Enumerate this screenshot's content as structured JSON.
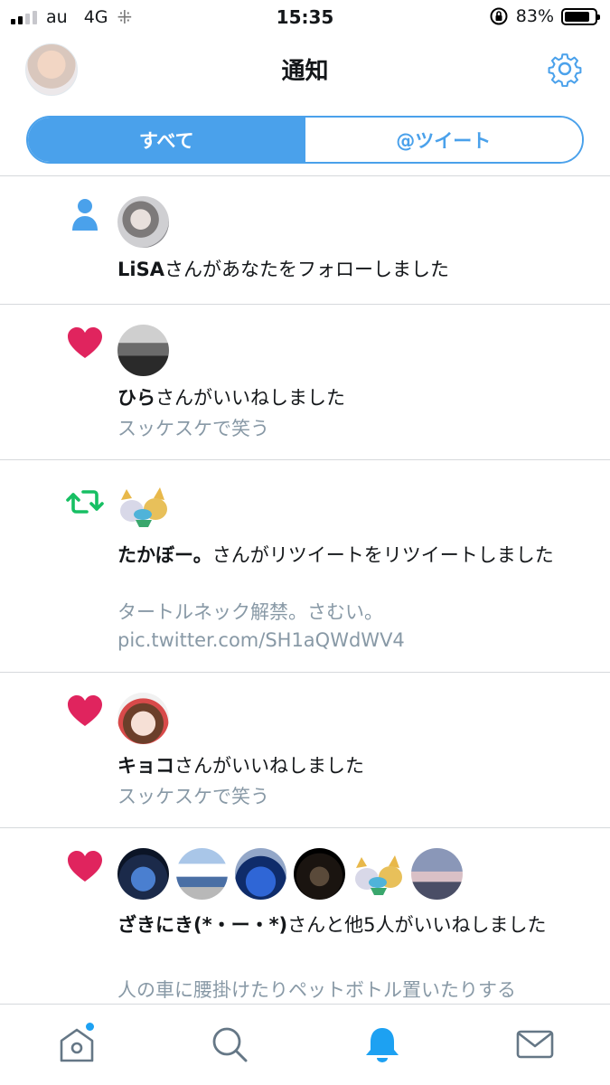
{
  "status_bar": {
    "carrier": "au",
    "network": "4G",
    "time": "15:35",
    "battery": "83%",
    "battery_level": 0.83,
    "signal_bars": 2
  },
  "header": {
    "title": "通知",
    "settings_icon": "gear-icon"
  },
  "tabs": {
    "all": "すべて",
    "mentions": "@ツイート",
    "active": "all"
  },
  "colors": {
    "accent": "#4aa1eb",
    "like": "#e0245e",
    "retweet": "#17bf63",
    "follow": "#4aa1eb",
    "secondary_text": "#8899a6"
  },
  "notifications": [
    {
      "type": "follow",
      "icon": "person-icon",
      "actor": "LiSA",
      "action": "さんがあなたをフォローしました",
      "tweet": ""
    },
    {
      "type": "like",
      "icon": "heart-icon",
      "actor": "ひら",
      "action": "さんがいいねしました",
      "tweet": "スッケスケで笑う"
    },
    {
      "type": "retweet",
      "icon": "retweet-icon",
      "actor": "たかぼー。",
      "action": "さんがリツイートをリツイートしました",
      "tweet": "タートルネック解禁。さむい。\npic.twitter.com/SH1aQWdWV4"
    },
    {
      "type": "like",
      "icon": "heart-icon",
      "actor": "キョコ",
      "action": "さんがいいねしました",
      "tweet": "スッケスケで笑う"
    },
    {
      "type": "like",
      "icon": "heart-icon",
      "actor": "ざきにき(*・ー・*)",
      "action": "さんと他5人がいいねしました",
      "tweet": "人の車に腰掛けたりペットボトル置いたりする"
    }
  ],
  "tab_bar": {
    "items": [
      "home-icon",
      "search-icon",
      "notifications-icon",
      "messages-icon"
    ],
    "active": "notifications-icon"
  }
}
